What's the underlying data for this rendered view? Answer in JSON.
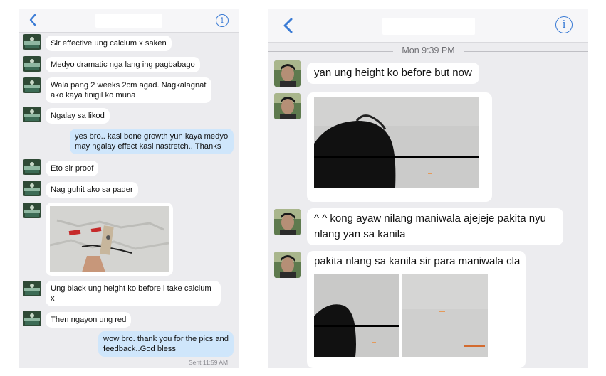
{
  "left_panel": {
    "header": {
      "back_icon": "chevron-left-icon",
      "info_icon": "info-icon",
      "info_glyph": "i"
    },
    "messages": [
      {
        "text": "Sir effective ung calcium x saken"
      },
      {
        "text": "Medyo dramatic nga lang ing pagbabago"
      },
      {
        "text": "Wala pang 2 weeks 2cm agad. Nagkalagnat ako kaya tinigil ko muna"
      },
      {
        "text": "Ngalay sa likod"
      },
      {
        "text": "yes bro.. kasi bone growth yun kaya medyo may ngalay effect kasi nastretch.. Thanks"
      },
      {
        "text": "Eto sir proof"
      },
      {
        "text": "Nag guhit ako sa pader"
      },
      {
        "text": "Ung black ung height ko before i take calcium x"
      },
      {
        "text": "Then ngayon ung red"
      },
      {
        "text": "wow bro. thank you for the pics and feedback..God bless"
      }
    ],
    "status": "Sent 11:59 AM"
  },
  "right_panel": {
    "header": {
      "back_icon": "chevron-left-icon",
      "info_icon": "info-icon",
      "info_glyph": "i"
    },
    "timestamp": "Mon 9:39 PM",
    "messages": [
      {
        "text": "yan ung height ko before but now"
      },
      {
        "text": "^ ^ kong ayaw nilang maniwala ajejeje pakita nyu nlang yan sa kanila"
      },
      {
        "text": "pakita nlang sa kanila sir para maniwala cla"
      }
    ]
  },
  "colors": {
    "accent": "#3a7bd5",
    "outgoing_bubble": "#cfe6fb",
    "incoming_bubble": "#ffffff",
    "background": "#ececef"
  }
}
